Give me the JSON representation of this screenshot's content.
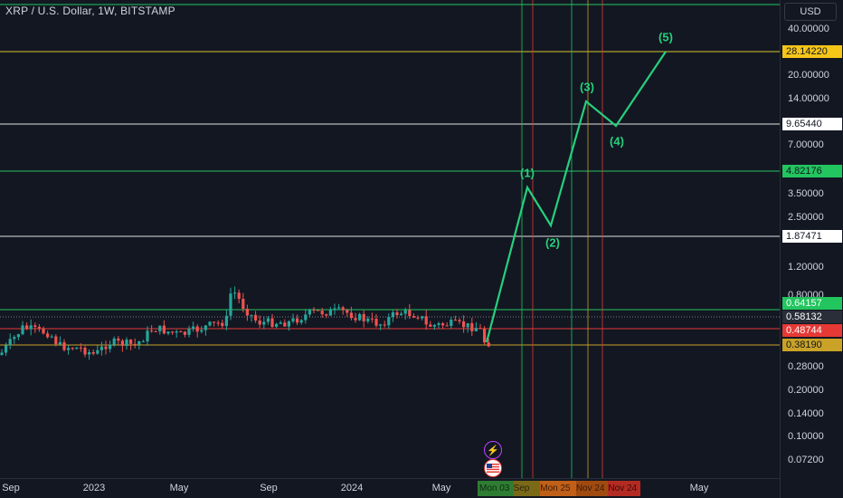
{
  "header": {
    "symbol_title": "XRP / U.S. Dollar, 1W, BITSTAMP"
  },
  "price_axis": {
    "currency_button": "USD",
    "ticks": [
      "40.00000",
      "20.00000",
      "14.00000",
      "7.00000",
      "3.50000",
      "2.50000",
      "1.20000",
      "0.80000",
      "0.28000",
      "0.20000",
      "0.14000",
      "0.10000",
      "0.07200"
    ],
    "tags": [
      {
        "label": "28.14220",
        "bg": "#f5c518",
        "fg": "#131722"
      },
      {
        "label": "9.65440",
        "bg": "#ffffff",
        "fg": "#131722"
      },
      {
        "label": "4.82176",
        "bg": "#22c55e",
        "fg": "#131722"
      },
      {
        "label": "1.87471",
        "bg": "#ffffff",
        "fg": "#131722"
      },
      {
        "label": "0.64157",
        "bg": "#22c55e",
        "fg": "#ffffff"
      },
      {
        "label": "0.58132",
        "bg": "#2a2e39",
        "fg": "#ffffff"
      },
      {
        "label": "0.48744",
        "bg": "#e53935",
        "fg": "#ffffff"
      },
      {
        "label": "0.38190",
        "bg": "#c9a227",
        "fg": "#131722"
      }
    ]
  },
  "time_axis": {
    "labels": [
      "Sep",
      "2023",
      "May",
      "Sep",
      "2024",
      "May",
      "May"
    ],
    "date_tags": [
      "Mon 03",
      "Sep",
      "Mon 25",
      "Nov 24",
      "Nov 24"
    ]
  },
  "waves": [
    "(1)",
    "(2)",
    "(3)",
    "(4)",
    "(5)"
  ],
  "icons": [
    "lightning-event-icon",
    "us-flag-icon"
  ],
  "colors": {
    "background": "#131722",
    "wave_line": "#26d07c",
    "up_candle": "#26a69a",
    "down_candle": "#ef5350",
    "yellow_level": "#d4c42a",
    "green_level": "#22c55e",
    "white_level": "#e0e0e0",
    "red_level": "#e53935"
  },
  "chart_data": {
    "type": "candlestick",
    "xlabel": "",
    "ylabel": "",
    "log_scale": true,
    "ylim": [
      0.06,
      60
    ],
    "horizontal_levels": [
      {
        "value": 28.1422,
        "color": "yellow"
      },
      {
        "value": 9.6544,
        "color": "white"
      },
      {
        "value": 4.82176,
        "color": "green"
      },
      {
        "value": 1.87471,
        "color": "white"
      },
      {
        "value": 0.64157,
        "color": "green"
      },
      {
        "value": 0.48744,
        "color": "red"
      },
      {
        "value": 0.3819,
        "color": "yellow"
      }
    ],
    "wave_projection": [
      {
        "label": "start",
        "value": 0.5
      },
      {
        "label": "(1)",
        "value": 3.8
      },
      {
        "label": "(2)",
        "value": 2.1
      },
      {
        "label": "(3)",
        "value": 13.0
      },
      {
        "label": "(4)",
        "value": 9.8
      },
      {
        "label": "(5)",
        "value": 30.0
      }
    ],
    "history_range": {
      "from": "Sep 2022",
      "to": "May 2024",
      "low": 0.3,
      "high": 0.93
    }
  }
}
